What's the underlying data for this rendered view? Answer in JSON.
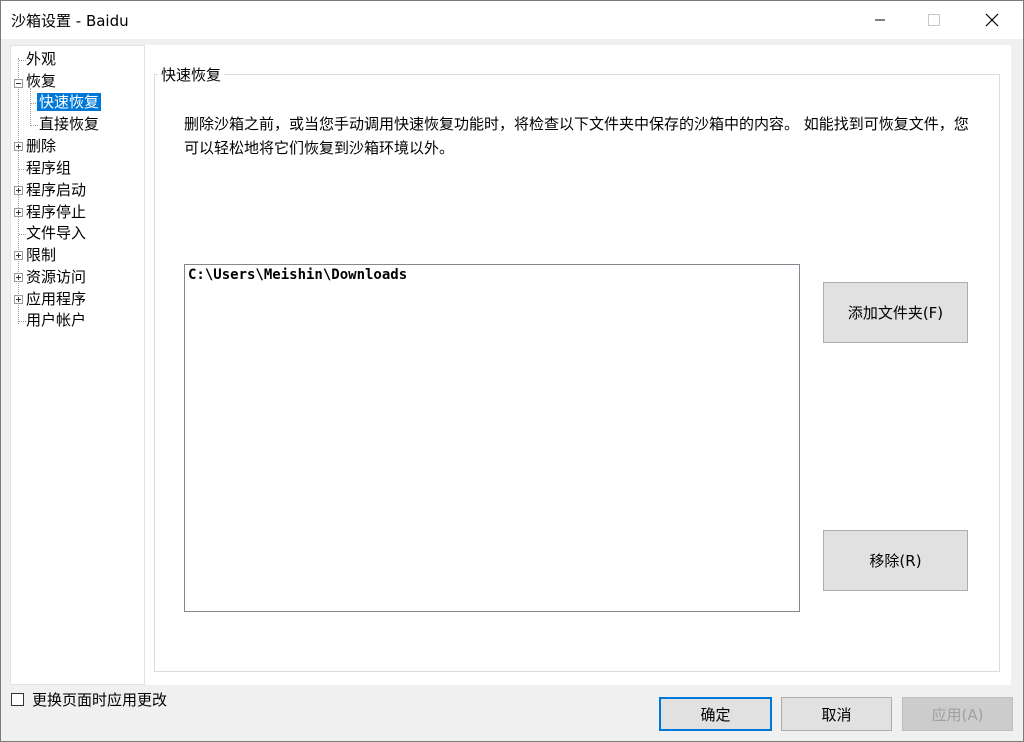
{
  "window": {
    "title": "沙箱设置 - Baidu"
  },
  "tree": {
    "items": [
      {
        "label": "外观"
      },
      {
        "label": "恢复"
      },
      {
        "label": "快速恢复"
      },
      {
        "label": "直接恢复"
      },
      {
        "label": "删除"
      },
      {
        "label": "程序组"
      },
      {
        "label": "程序启动"
      },
      {
        "label": "程序停止"
      },
      {
        "label": "文件导入"
      },
      {
        "label": "限制"
      },
      {
        "label": "资源访问"
      },
      {
        "label": "应用程序"
      },
      {
        "label": "用户帐户"
      }
    ]
  },
  "panel": {
    "group_label": "快速恢复",
    "description": "删除沙箱之前，或当您手动调用快速恢复功能时，将检查以下文件夹中保存的沙箱中的内容。 如能找到可恢复文件，您可以轻松地将它们恢复到沙箱环境以外。",
    "folders": [
      "C:\\Users\\Meishin\\Downloads"
    ],
    "add_button": "添加文件夹(F)",
    "remove_button": "移除(R)"
  },
  "footer": {
    "apply_on_change_label": "更换页面时应用更改",
    "ok_button": "确定",
    "cancel_button": "取消",
    "apply_button": "应用(A)"
  }
}
